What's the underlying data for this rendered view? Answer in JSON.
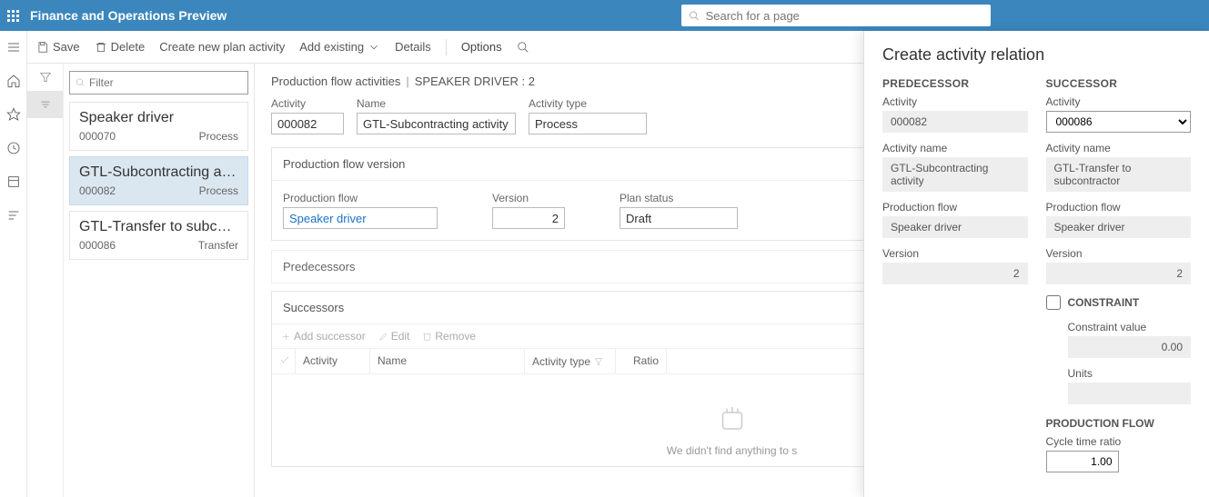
{
  "header": {
    "app_title": "Finance and Operations Preview",
    "search_placeholder": "Search for a page"
  },
  "actions": {
    "save": "Save",
    "delete": "Delete",
    "create": "Create new plan activity",
    "add_existing": "Add existing",
    "details": "Details",
    "options": "Options"
  },
  "list": {
    "filter_placeholder": "Filter",
    "items": [
      {
        "title": "Speaker driver",
        "id": "000070",
        "type": "Process"
      },
      {
        "title": "GTL-Subcontracting activ...",
        "id": "000082",
        "type": "Process"
      },
      {
        "title": "GTL-Transfer to subcontr...",
        "id": "000086",
        "type": "Transfer"
      }
    ]
  },
  "breadcrumb": {
    "a": "Production flow activities",
    "b": "SPEAKER DRIVER : 2"
  },
  "detail": {
    "activity_label": "Activity",
    "activity_value": "000082",
    "name_label": "Name",
    "name_value": "GTL-Subcontracting activity",
    "type_label": "Activity type",
    "type_value": "Process"
  },
  "pfv": {
    "title": "Production flow version",
    "flow_label": "Production flow",
    "flow_value": "Speaker driver",
    "version_label": "Version",
    "version_value": "2",
    "status_label": "Plan status",
    "status_value": "Draft"
  },
  "pred": {
    "title": "Predecessors"
  },
  "succ": {
    "title": "Successors",
    "add": "Add successor",
    "edit": "Edit",
    "remove": "Remove",
    "cols": {
      "activity": "Activity",
      "name": "Name",
      "type": "Activity type",
      "ratio": "Ratio"
    },
    "empty": "We didn't find anything to s"
  },
  "panel": {
    "title": "Create activity relation",
    "pred_h": "PREDECESSOR",
    "succ_h": "SUCCESSOR",
    "labels": {
      "activity": "Activity",
      "activity_name": "Activity name",
      "production_flow": "Production flow",
      "version": "Version"
    },
    "pred": {
      "activity": "000082",
      "name": "GTL-Subcontracting activity",
      "flow": "Speaker driver",
      "version": "2"
    },
    "succ": {
      "activity": "000086",
      "name": "GTL-Transfer to subcontractor",
      "flow": "Speaker driver",
      "version": "2"
    },
    "constraint_label": "CONSTRAINT",
    "cv_label": "Constraint value",
    "cv_value": "0.00",
    "units_label": "Units",
    "units_value": "",
    "pf_h": "PRODUCTION FLOW",
    "ctr_label": "Cycle time ratio",
    "ctr_value": "1.00"
  }
}
